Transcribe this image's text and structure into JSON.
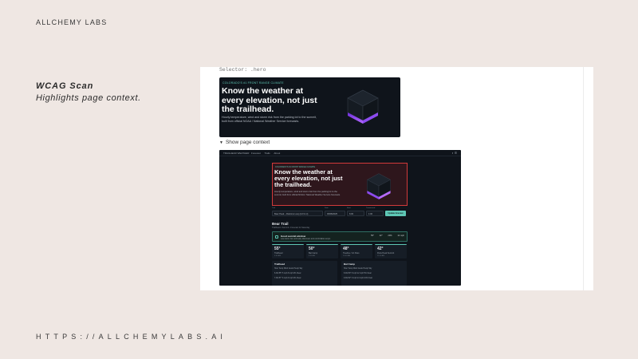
{
  "slide": {
    "brand": "ALLCHEMY LABS",
    "title": "WCAG Scan",
    "subtitle": "Highlights page context.",
    "footer_url": "HTTPS://ALLCHEMYLABS.AI"
  },
  "panel": {
    "selector_line": "Selector: .hero",
    "hero": {
      "eyebrow": "Colorado's #1 Front Range Climate",
      "headline": "Know the weather at every elevation, not just the trailhead.",
      "body": "Hourly temperature, wind and storm risk from the parking lot to the summit, built from official NOAA / National Weather Service forecasts."
    },
    "disclosure": "Show page context"
  },
  "context_shot": {
    "nav": {
      "logo": "TRAILHEAD WEATHER",
      "links": [
        "Forecast",
        "Trails",
        "About"
      ]
    },
    "hero": {
      "eyebrow": "Colorado's #1 Front Range Climate",
      "headline": "Know the weather at every elevation, not just the trailhead.",
      "body": "Hourly temperature, wind and storm risk from the parking lot to the summit, built from official NOAA / National Weather Service forecasts."
    },
    "form": {
      "trail_label": "Trail",
      "trail_value": "Bear Peak – Flatirons Loop (12.9 mi)",
      "date_label": "Date",
      "date_value": "06/08/2025",
      "start_label": "Start",
      "start_value": "6:00",
      "end_label": "Turnaround",
      "end_value": "1:00",
      "update_button": "Update forecast"
    },
    "trail": {
      "title": "Bear Trail",
      "subtitle": "Trailhead • Summit • Forecast for Saturday",
      "alert_title": "Good summit window",
      "alert_text": "Low storm risk until early afternoon and comfortable temps.",
      "stats": [
        "55°",
        "42°",
        "20%",
        "12 mph"
      ]
    },
    "metrics": [
      {
        "value": "55°",
        "label": "Trailhead",
        "sub": "6:00 AM"
      },
      {
        "value": "50°",
        "label": "Bat Camp",
        "sub": "8:30 AM"
      },
      {
        "value": "48°",
        "label": "Treeline / Jct Pass",
        "sub": "10:00 AM"
      },
      {
        "value": "42°",
        "label": "Flora Peak Summit",
        "sub": "11:30 AM"
      }
    ],
    "tables": [
      {
        "title": "Trailhead",
        "rows": [
          "Hour   Temp   Wind   Gusts   Precip   Sky",
          "6 AM   55°    5 mph   8 mph   0%   Clear",
          "7 AM   57°    6 mph   9 mph   0%   Clear"
        ]
      },
      {
        "title": "Bat Camp",
        "rows": [
          "Hour   Temp   Wind   Gusts   Precip   Sky",
          "8 AM   50°    8 mph   12 mph   5%   Clear",
          "9 AM   52°    9 mph   14 mph   10%   Clear"
        ]
      }
    ]
  }
}
